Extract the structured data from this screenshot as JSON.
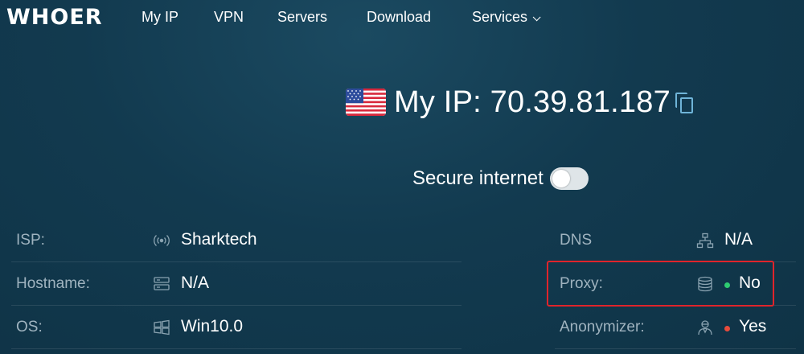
{
  "nav": {
    "logo": "WHOER",
    "items": [
      {
        "label": "My IP"
      },
      {
        "label": "VPN"
      },
      {
        "label": "Servers"
      },
      {
        "label": "Download"
      },
      {
        "label": "Services"
      }
    ]
  },
  "hero": {
    "title": "My IP: 70.39.81.187",
    "flag_icon": "us-flag-icon",
    "copy_icon": "copy-icon"
  },
  "secure": {
    "label": "Secure internet",
    "toggle_on": false
  },
  "left_rows": [
    {
      "label": "ISP:",
      "icon": "signal-icon",
      "value": "Sharktech"
    },
    {
      "label": "Hostname:",
      "icon": "server-icon",
      "value": "N/A"
    },
    {
      "label": "OS:",
      "icon": "windows-icon",
      "value": "Win10.0"
    }
  ],
  "right_rows": [
    {
      "label": "DNS",
      "icon": "network-icon",
      "value": "N/A"
    },
    {
      "label": "Proxy:",
      "icon": "database-icon",
      "value": "No",
      "status_color": "#2ecc71"
    },
    {
      "label": "Anonymizer:",
      "icon": "user-icon",
      "value": "Yes",
      "status_color": "#e74c3c"
    }
  ],
  "colors": {
    "background": "#123a4f",
    "label": "#9fb3bf",
    "accent": "#6fb4d8",
    "highlight": "#e0242b"
  }
}
